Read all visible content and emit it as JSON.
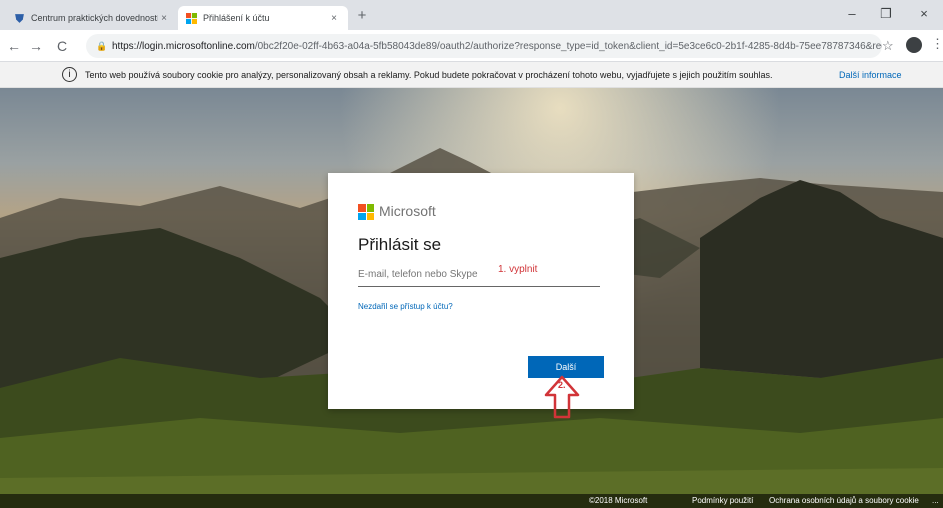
{
  "browser": {
    "tabs": [
      {
        "title": "Centrum praktických dovedností",
        "close": "×"
      },
      {
        "title": "Přihlášení k účtu",
        "close": "×"
      }
    ],
    "new_tab": "+",
    "window_controls": {
      "minimize": "–",
      "maximize": "❐",
      "close": "×"
    },
    "nav": {
      "back": "←",
      "forward": "→",
      "reload": "C"
    },
    "url_host": "https://login.microsoftonline.com",
    "url_path": "/0bc2f20e-02ff-4b63-a04a-5fb58043de89/oauth2/authorize?response_type=id_token&client_id=5e3ce6c0-2b1f-4285-8d4b-75ee78787346&red...",
    "star": "☆",
    "menu": "⋮"
  },
  "cookie_bar": {
    "icon": "i",
    "text": "Tento web používá soubory cookie pro analýzy, personalizovaný obsah a reklamy. Pokud budete pokračovat v procházení tohoto webu, vyjadřujete s jejich použitím souhlas.",
    "more_link": "Další informace"
  },
  "signin": {
    "brand": "Microsoft",
    "logo_colors": [
      "#f25022",
      "#7fba00",
      "#00a4ef",
      "#ffb900"
    ],
    "heading": "Přihlásit se",
    "email_placeholder": "E-mail, telefon nebo Skype",
    "email_value": "",
    "annotation_fill": "1. vyplnit",
    "cant_access": "Nezdařil se přístup k účtu?",
    "next_button": "Další",
    "annotation_click": "2."
  },
  "footer": {
    "copyright": "©2018 Microsoft",
    "terms": "Podmínky použití",
    "privacy": "Ochrana osobních údajů a soubory cookie",
    "more": "..."
  },
  "colors": {
    "accent": "#0067b8",
    "annotation": "#d13438"
  }
}
